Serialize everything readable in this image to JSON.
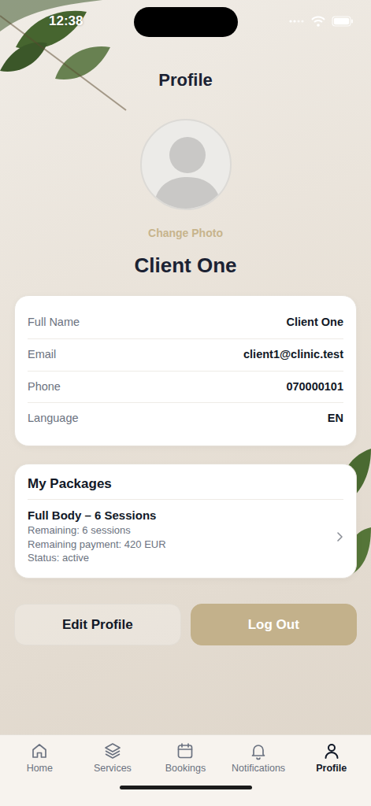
{
  "status_bar": {
    "time": "12:38"
  },
  "header": {
    "title": "Profile"
  },
  "avatar": {
    "action": "Change Photo"
  },
  "display_name": "Client One",
  "info": [
    {
      "label": "Full Name",
      "value": "Client One"
    },
    {
      "label": "Email",
      "value": "client1@clinic.test"
    },
    {
      "label": "Phone",
      "value": "070000101"
    },
    {
      "label": "Language",
      "value": "EN"
    }
  ],
  "packages": {
    "title": "My Packages",
    "items": [
      {
        "name": "Full Body – 6 Sessions",
        "lines": [
          "Remaining: 6 sessions",
          "Remaining payment: 420 EUR",
          "Status: active"
        ]
      }
    ]
  },
  "buttons": [
    {
      "label": "Edit Profile",
      "kind": "outline"
    },
    {
      "label": "Log Out",
      "kind": "filled"
    }
  ],
  "tab_bar": [
    {
      "label": "Home",
      "selected": false
    },
    {
      "label": "Services",
      "selected": false
    },
    {
      "label": "Bookings",
      "selected": false
    },
    {
      "label": "Notifications",
      "selected": false
    },
    {
      "label": "Profile",
      "selected": true
    }
  ]
}
